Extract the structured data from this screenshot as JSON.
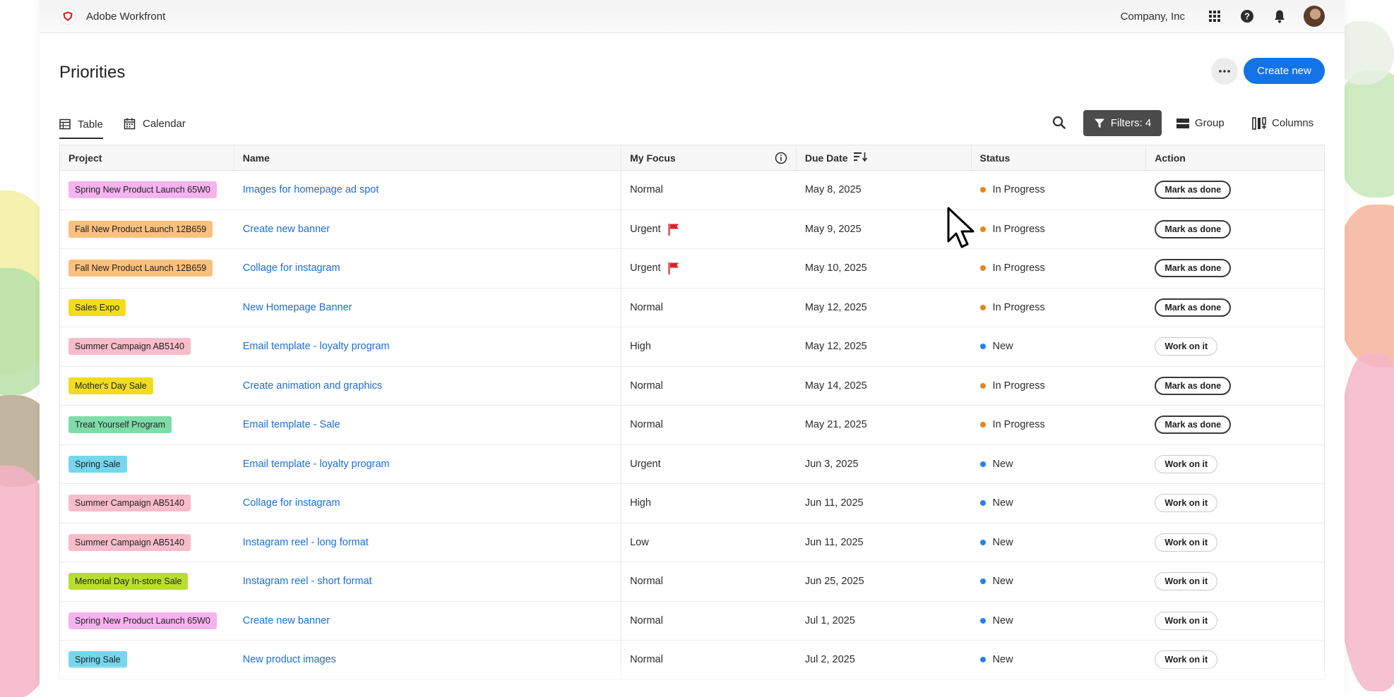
{
  "app": {
    "name": "Adobe Workfront",
    "company": "Company, Inc"
  },
  "topbar": {
    "icons": [
      "apps-grid-icon",
      "help-icon",
      "bell-icon",
      "user-avatar"
    ]
  },
  "page": {
    "title": "Priorities",
    "create_label": "Create new"
  },
  "views": [
    {
      "label": "Table",
      "active": true
    },
    {
      "label": "Calendar",
      "active": false
    }
  ],
  "toolbar": {
    "filters_label": "Filters: 4",
    "group_label": "Group",
    "columns_label": "Columns"
  },
  "table": {
    "columns": [
      "Project",
      "Name",
      "My Focus",
      "Due Date",
      "Status",
      "Action"
    ],
    "rows": [
      {
        "project": "Spring New Product Launch 65W0",
        "project_color": "#f5b3ef",
        "name": "Images for homepage ad spot",
        "focus": "Normal",
        "flag": false,
        "due": "May 8, 2025",
        "status": "In Progress",
        "action": "Mark as done"
      },
      {
        "project": "Fall New Product Launch 12B659",
        "project_color": "#f9c07e",
        "name": "Create new banner",
        "focus": "Urgent",
        "flag": true,
        "due": "May 9, 2025",
        "status": "In Progress",
        "action": "Mark as done"
      },
      {
        "project": "Fall New Product Launch 12B659",
        "project_color": "#f9c07e",
        "name": "Collage for instagram",
        "focus": "Urgent",
        "flag": true,
        "due": "May 10, 2025",
        "status": "In Progress",
        "action": "Mark as done"
      },
      {
        "project": "Sales Expo",
        "project_color": "#f1dd1c",
        "name": "New Homepage Banner",
        "focus": "Normal",
        "flag": false,
        "due": "May 12, 2025",
        "status": "In Progress",
        "action": "Mark as done"
      },
      {
        "project": "Summer Campaign AB5140",
        "project_color": "#f8bccb",
        "name": "Email template - loyalty program",
        "focus": "High",
        "flag": false,
        "due": "May 12, 2025",
        "status": "New",
        "action": "Work on it"
      },
      {
        "project": "Mother's Day Sale",
        "project_color": "#f1dd1c",
        "name": "Create animation and graphics",
        "focus": "Normal",
        "flag": false,
        "due": "May 14, 2025",
        "status": "In Progress",
        "action": "Mark as done"
      },
      {
        "project": "Treat Yourself Program",
        "project_color": "#7fdca9",
        "name": "Email template - Sale",
        "focus": "Normal",
        "flag": false,
        "due": "May 21, 2025",
        "status": "In Progress",
        "action": "Mark as done"
      },
      {
        "project": "Spring Sale",
        "project_color": "#76d6ec",
        "name": "Email template - loyalty program",
        "focus": "Urgent",
        "flag": false,
        "due": "Jun 3, 2025",
        "status": "New",
        "action": "Work on it"
      },
      {
        "project": "Summer Campaign AB5140",
        "project_color": "#f8bccb",
        "name": "Collage for instagram",
        "focus": "High",
        "flag": false,
        "due": "Jun 11, 2025",
        "status": "New",
        "action": "Work on it"
      },
      {
        "project": "Summer Campaign AB5140",
        "project_color": "#f8bccb",
        "name": "Instagram reel - long format",
        "focus": "Low",
        "flag": false,
        "due": "Jun 11, 2025",
        "status": "New",
        "action": "Work on it"
      },
      {
        "project": "Memorial Day In-store Sale",
        "project_color": "#b7df2b",
        "name": "Instagram reel - short format",
        "focus": "Normal",
        "flag": false,
        "due": "Jun 25, 2025",
        "status": "New",
        "action": "Work on it"
      },
      {
        "project": "Spring New Product Launch 65W0",
        "project_color": "#f5b3ef",
        "name": "Create new banner",
        "focus": "Normal",
        "flag": false,
        "due": "Jul 1, 2025",
        "status": "New",
        "action": "Work on it"
      },
      {
        "project": "Spring Sale",
        "project_color": "#76d6ec",
        "name": "New product images",
        "focus": "Normal",
        "flag": false,
        "due": "Jul 2, 2025",
        "status": "New",
        "action": "Work on it"
      }
    ]
  },
  "status_colors": {
    "In Progress": "#e68619",
    "New": "#2680eb"
  },
  "accent_color": "#1473e6"
}
